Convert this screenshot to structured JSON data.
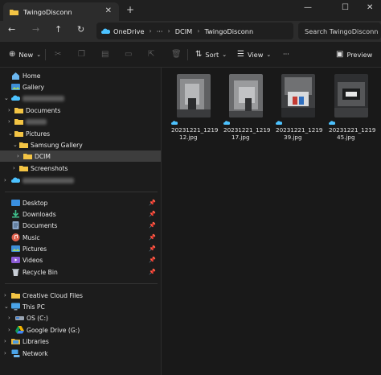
{
  "window": {
    "tab_title": "TwingoDisconn",
    "new_tab": "+",
    "close_tab": "✕",
    "minimize": "—",
    "maximize": "☐",
    "close": "✕"
  },
  "address": {
    "crumbs": [
      "OneDrive",
      "DCIM",
      "TwingoDisconn"
    ],
    "more": "···",
    "search_placeholder": "Search TwingoDisconn"
  },
  "toolbar": {
    "new_label": "New",
    "sort_label": "Sort",
    "view_label": "View",
    "more": "···",
    "preview_label": "Preview"
  },
  "sidebar": {
    "home": "Home",
    "gallery": "Gallery",
    "documents": "Documents",
    "pictures": "Pictures",
    "samsung_gallery": "Samsung Gallery",
    "dcim": "DCIM",
    "screenshots": "Screenshots",
    "quick": [
      "Desktop",
      "Downloads",
      "Documents",
      "Music",
      "Pictures",
      "Videos",
      "Recycle Bin"
    ],
    "creative_cloud": "Creative Cloud Files",
    "this_pc": "This PC",
    "os_c": "OS (C:)",
    "google_drive": "Google Drive (G:)",
    "libraries": "Libraries",
    "network": "Network"
  },
  "files": [
    {
      "line1": "20231221_1219",
      "line2": "12.jpg"
    },
    {
      "line1": "20231221_1219",
      "line2": "17.jpg"
    },
    {
      "line1": "20231221_1219",
      "line2": "39.jpg"
    },
    {
      "line1": "20231221_1219",
      "line2": "45.jpg"
    }
  ],
  "colors": {
    "accent": "#4cc2ff",
    "folder": "#f3c444",
    "selected": "#3d3d3d"
  }
}
